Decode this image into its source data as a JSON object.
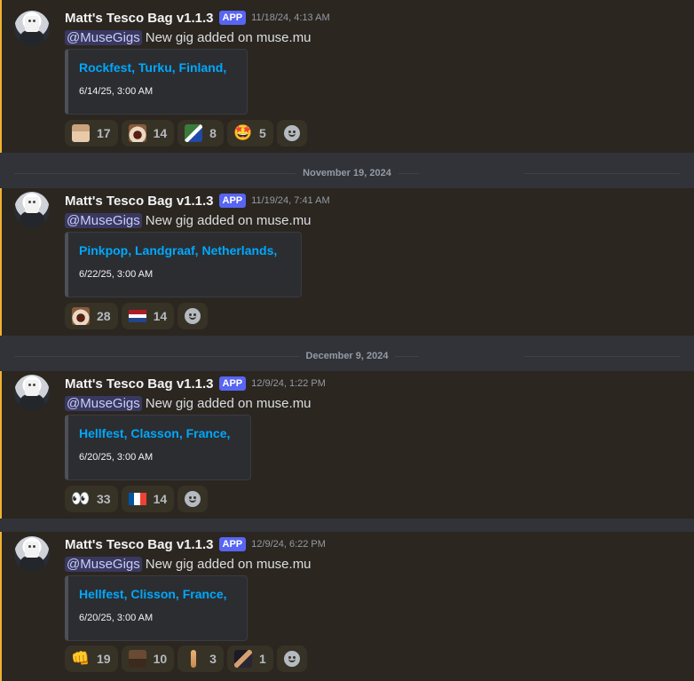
{
  "messages": [
    {
      "username": "Matt's Tesco Bag v1.1.3",
      "app_tag": "APP",
      "timestamp": "11/18/24, 4:13 AM",
      "mention": "@MuseGigs",
      "text": "New gig added on muse.mu",
      "embed": {
        "title": "Rockfest, Turku, Finland,",
        "date": "6/14/25, 3:00 AM"
      },
      "reactions": [
        {
          "emoji": "man-face-custom-emoji",
          "count": "17"
        },
        {
          "emoji": "screaming-face-custom-emoji",
          "count": "14"
        },
        {
          "emoji": "finland-flag-custom-emoji",
          "count": "8"
        },
        {
          "emoji": "star-struck-emoji",
          "glyph": "🤩",
          "count": "5"
        }
      ]
    },
    {
      "username": "Matt's Tesco Bag v1.1.3",
      "app_tag": "APP",
      "timestamp": "11/19/24, 7:41 AM",
      "mention": "@MuseGigs",
      "text": "New gig added on muse.mu",
      "embed": {
        "title": "Pinkpop, Landgraaf, Netherlands,",
        "date": "6/22/25, 3:00 AM"
      },
      "reactions": [
        {
          "emoji": "screaming-face-custom-emoji",
          "count": "28"
        },
        {
          "emoji": "netherlands-flag-emoji",
          "count": "14"
        }
      ]
    },
    {
      "username": "Matt's Tesco Bag v1.1.3",
      "app_tag": "APP",
      "timestamp": "12/9/24, 1:22 PM",
      "mention": "@MuseGigs",
      "text": "New gig added on muse.mu",
      "embed": {
        "title": "Hellfest, Classon, France,",
        "date": "6/20/25, 3:00 AM"
      },
      "reactions": [
        {
          "emoji": "eyes-emoji",
          "glyph": "👀",
          "count": "33"
        },
        {
          "emoji": "france-flag-emoji",
          "count": "14"
        }
      ]
    },
    {
      "username": "Matt's Tesco Bag v1.1.3",
      "app_tag": "APP",
      "timestamp": "12/9/24, 6:22 PM",
      "mention": "@MuseGigs",
      "text": "New gig added on muse.mu",
      "embed": {
        "title": "Hellfest, Clisson, France,",
        "date": "6/20/25, 3:00 AM"
      },
      "reactions": [
        {
          "emoji": "fist-bump-emoji",
          "glyph": "👊",
          "count": "19"
        },
        {
          "emoji": "photo-custom-emoji",
          "count": "10"
        },
        {
          "emoji": "bandage-custom-emoji",
          "count": "3"
        },
        {
          "emoji": "guitarist-custom-emoji",
          "count": "1"
        }
      ]
    }
  ],
  "dividers": [
    "November 19, 2024",
    "December 9, 2024"
  ],
  "colors": {
    "mention_bar": "#f0b232",
    "app_tag": "#5865f2",
    "link": "#00a8fc"
  }
}
